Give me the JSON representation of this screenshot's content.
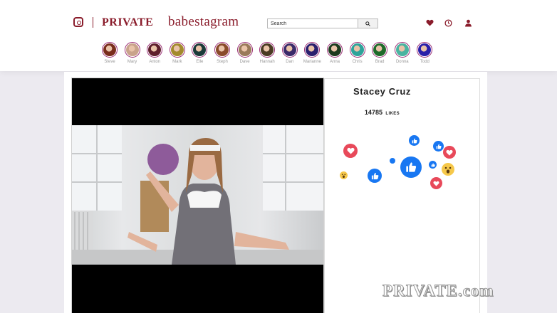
{
  "header": {
    "brand_private": "PRIVATE",
    "brand_babes": "babestagram",
    "search": {
      "placeholder": "Search"
    },
    "icons": [
      "instagram-icon",
      "heart-icon",
      "clock-icon",
      "user-icon"
    ],
    "stories": [
      {
        "name": "Steve",
        "color": "#7a2d1c"
      },
      {
        "name": "Mary",
        "color": "#c9a38b"
      },
      {
        "name": "Anton",
        "color": "#5e1f2c"
      },
      {
        "name": "Mark",
        "color": "#a38a2c"
      },
      {
        "name": "Elle",
        "color": "#1b3a3a"
      },
      {
        "name": "Steph",
        "color": "#8a4a2a"
      },
      {
        "name": "Dave",
        "color": "#9a7a5a"
      },
      {
        "name": "Hannah",
        "color": "#4a3a22"
      },
      {
        "name": "Dan",
        "color": "#3b2a6a"
      },
      {
        "name": "Marianne",
        "color": "#2a1f6e"
      },
      {
        "name": "Anna",
        "color": "#1e3a1e"
      },
      {
        "name": "Chris",
        "color": "#2ea39a"
      },
      {
        "name": "Brad",
        "color": "#1f6a2a"
      },
      {
        "name": "Donna",
        "color": "#4ab3a0"
      },
      {
        "name": "Todd",
        "color": "#2a1fa8"
      }
    ]
  },
  "post": {
    "model_name": "Stacey Cruz",
    "likes_count": "14785",
    "likes_label": "LIKES"
  },
  "watermark": "PRIVATE.com",
  "colors": {
    "brand": "#8a1c2b",
    "story_ring": "#9c2f76",
    "like_blue": "#1877f2",
    "love_red": "#e8495a"
  }
}
